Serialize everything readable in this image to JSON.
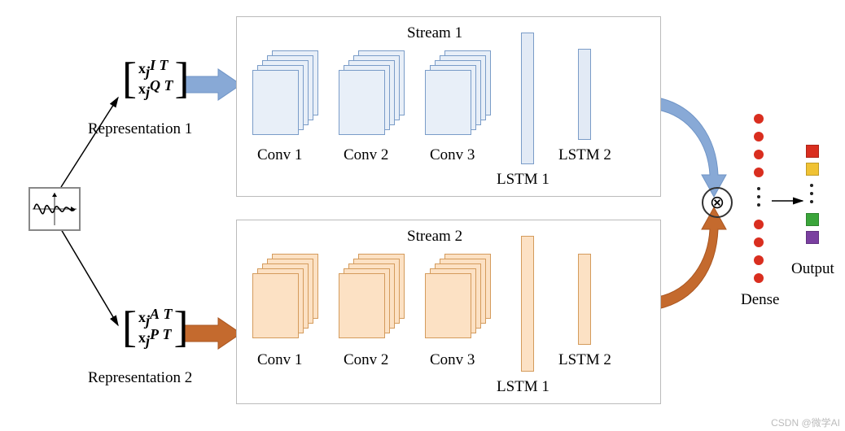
{
  "stream1": {
    "title": "Stream 1",
    "conv1": "Conv 1",
    "conv2": "Conv 2",
    "conv3": "Conv 3",
    "lstm1": "LSTM 1",
    "lstm2": "LSTM 2"
  },
  "stream2": {
    "title": "Stream 2",
    "conv1": "Conv 1",
    "conv2": "Conv 2",
    "conv3": "Conv 3",
    "lstm1": "LSTM 1",
    "lstm2": "LSTM 2"
  },
  "repr1_label": "Representation 1",
  "repr2_label": "Representation 2",
  "dense_label": "Dense",
  "output_label": "Output",
  "merge_symbol": "⊗",
  "watermark": "CSDN @微学AI",
  "colors": {
    "blue_fill": "#e8eff8",
    "blue_stroke": "#7a9cc8",
    "blue_arrow": "#88a9d6",
    "orange_fill": "#fce1c4",
    "orange_stroke": "#d49b5c",
    "orange_arrow": "#c46a2e",
    "dense_dot": "#d92e1f",
    "out_red": "#d92e1f",
    "out_yellow": "#f0c233",
    "out_green": "#3aa53a",
    "out_purple": "#7a3fa0"
  },
  "repr1_matrix_rows": [
    "x_j^{I T}",
    "x_j^{Q T}"
  ],
  "repr2_matrix_rows": [
    "x_j^{A T}",
    "x_j^{P T}"
  ]
}
